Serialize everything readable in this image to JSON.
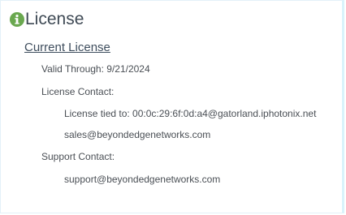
{
  "panel": {
    "title": "License",
    "icon": "info-circle-icon",
    "accent_color": "#6aa84f"
  },
  "section": {
    "link_label": "Current License"
  },
  "details": {
    "valid_through": "Valid Through: 9/21/2024",
    "license_contact_label": "License Contact:",
    "license_tied_to": "License tied to: 00:0c:29:6f:0d:a4@gatorland.iphotonix.net",
    "license_contact_email": "sales@beyondedgenetworks.com",
    "support_contact_label": "Support Contact:",
    "support_contact_email": "support@beyondedgenetworks.com"
  }
}
